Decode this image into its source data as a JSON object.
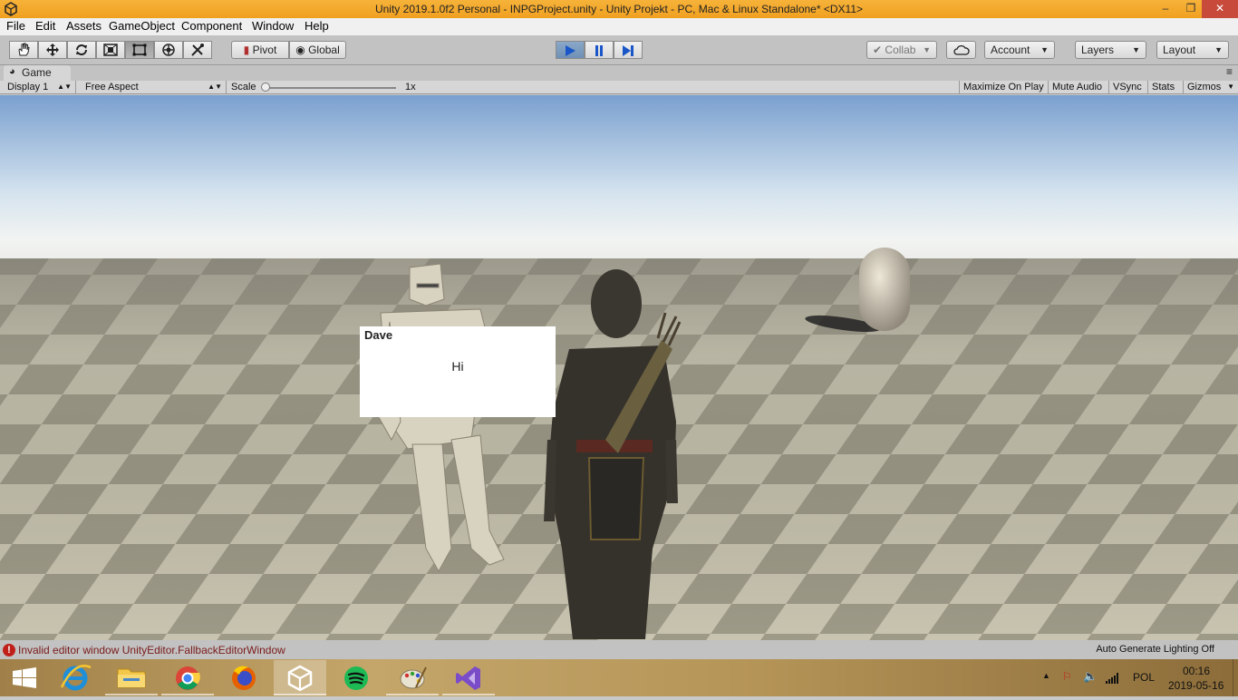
{
  "window": {
    "title": "Unity 2019.1.0f2 Personal - INPGProject.unity - Unity Projekt - PC, Mac & Linux Standalone* <DX11>",
    "controls": [
      "minimize",
      "maximize",
      "close"
    ]
  },
  "menu": [
    "File",
    "Edit",
    "Assets",
    "GameObject",
    "Component",
    "Window",
    "Help"
  ],
  "toolbar": {
    "tools": [
      "hand-tool",
      "move-tool",
      "rotate-tool",
      "scale-tool",
      "rect-tool",
      "transform-tool",
      "custom-tool"
    ],
    "active_tool": "rect-tool",
    "pivot_label": "Pivot",
    "global_label": "Global",
    "collab_label": "Collab",
    "account_label": "Account",
    "layers_label": "Layers",
    "layout_label": "Layout"
  },
  "game_view": {
    "tab_label": "Game",
    "display": "Display 1",
    "aspect": "Free Aspect",
    "scale_label": "Scale",
    "scale_value": "1x",
    "options": [
      "Maximize On Play",
      "Mute Audio",
      "VSync",
      "Stats",
      "Gizmos"
    ]
  },
  "dialog": {
    "speaker": "Dave",
    "message": "Hi"
  },
  "status": {
    "error": "Invalid editor window UnityEditor.FallbackEditorWindow",
    "lighting": "Auto Generate Lighting Off"
  },
  "taskbar": {
    "apps": [
      "windows-start",
      "internet-explorer",
      "file-explorer",
      "chrome",
      "firefox",
      "unity",
      "spotify",
      "paint",
      "visual-studio"
    ],
    "active_app": "unity",
    "language": "POL",
    "time": "00:16",
    "date": "2019-05-16"
  },
  "colors": {
    "title_bar": "#f0a020",
    "toolbar": "#c2c2c2",
    "play_active": "#6f90b6",
    "error": "#c0201a"
  }
}
